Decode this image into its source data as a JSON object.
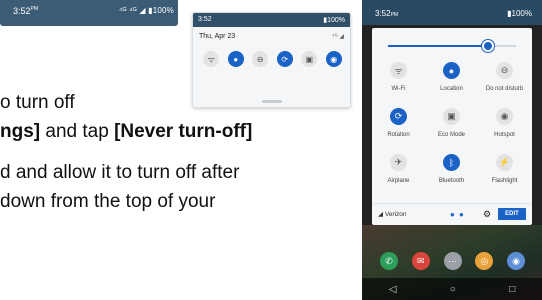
{
  "statusbar_thumb": {
    "time": "3:52",
    "ampm": "PM",
    "status_icons": "⁴ᴳ ⁴ᴳ ◢ ▮100%"
  },
  "instructions": {
    "line1": "o turn off",
    "line2_bold": "ngs]",
    "line2_mid": " and tap ",
    "line2_bold2": "[Never turn-off]",
    "line3": "d and allow it to turn off after",
    "line4": "down from the top of your"
  },
  "small_panel": {
    "time": "3:52",
    "battery": "▮100%",
    "date": "Thu, Apr 23",
    "signal": "⁴ᴳ ◢",
    "tiles": [
      {
        "icon": "wifi-icon",
        "glyph": "ᯤ",
        "state": "off"
      },
      {
        "icon": "location-icon",
        "glyph": "●",
        "state": "on"
      },
      {
        "icon": "do-not-disturb-icon",
        "glyph": "⊖",
        "state": "off"
      },
      {
        "icon": "rotation-icon",
        "glyph": "⟳",
        "state": "on"
      },
      {
        "icon": "eco-mode-icon",
        "glyph": "▣",
        "state": "off"
      },
      {
        "icon": "hotspot-icon",
        "glyph": "◉",
        "state": "on"
      }
    ]
  },
  "phone": {
    "time": "3:52",
    "ampm": "PM",
    "battery": "▮100%",
    "brightness": 0.78,
    "tiles": [
      {
        "label": "Wi-Fi",
        "icon": "wifi-icon",
        "glyph": "ᯤ",
        "state": "off"
      },
      {
        "label": "Location",
        "icon": "location-icon",
        "glyph": "●",
        "state": "on"
      },
      {
        "label": "Do not disturb",
        "icon": "do-not-disturb-icon",
        "glyph": "⊖",
        "state": "off"
      },
      {
        "label": "Rotation",
        "icon": "rotation-icon",
        "glyph": "⟳",
        "state": "on"
      },
      {
        "label": "Eco Mode",
        "icon": "eco-mode-icon",
        "glyph": "▣",
        "state": "off"
      },
      {
        "label": "Hotspot",
        "icon": "hotspot-icon",
        "glyph": "◉",
        "state": "off"
      },
      {
        "label": "Airplane",
        "icon": "airplane-icon",
        "glyph": "✈",
        "state": "off"
      },
      {
        "label": "Bluetooth",
        "icon": "bluetooth-icon",
        "glyph": "ᛒ",
        "state": "on"
      },
      {
        "label": "Flashlight",
        "icon": "flashlight-icon",
        "glyph": "⚡",
        "state": "off"
      }
    ],
    "carrier": "Verizon",
    "edit_label": "EDIT",
    "dock": [
      {
        "icon": "phone-icon",
        "glyph": "✆",
        "color": "#2e9e5b"
      },
      {
        "icon": "messages-icon",
        "glyph": "✉",
        "color": "#d9453d"
      },
      {
        "icon": "apps-icon",
        "glyph": "⋯",
        "color": "#9aa0a6"
      },
      {
        "icon": "chrome-icon",
        "glyph": "◎",
        "color": "#e9a23b"
      },
      {
        "icon": "camera-icon",
        "glyph": "◉",
        "color": "#5c8fd6"
      }
    ],
    "nav": [
      {
        "icon": "back-icon",
        "glyph": "◁"
      },
      {
        "icon": "home-icon",
        "glyph": "○"
      },
      {
        "icon": "recents-icon",
        "glyph": "□"
      }
    ]
  }
}
